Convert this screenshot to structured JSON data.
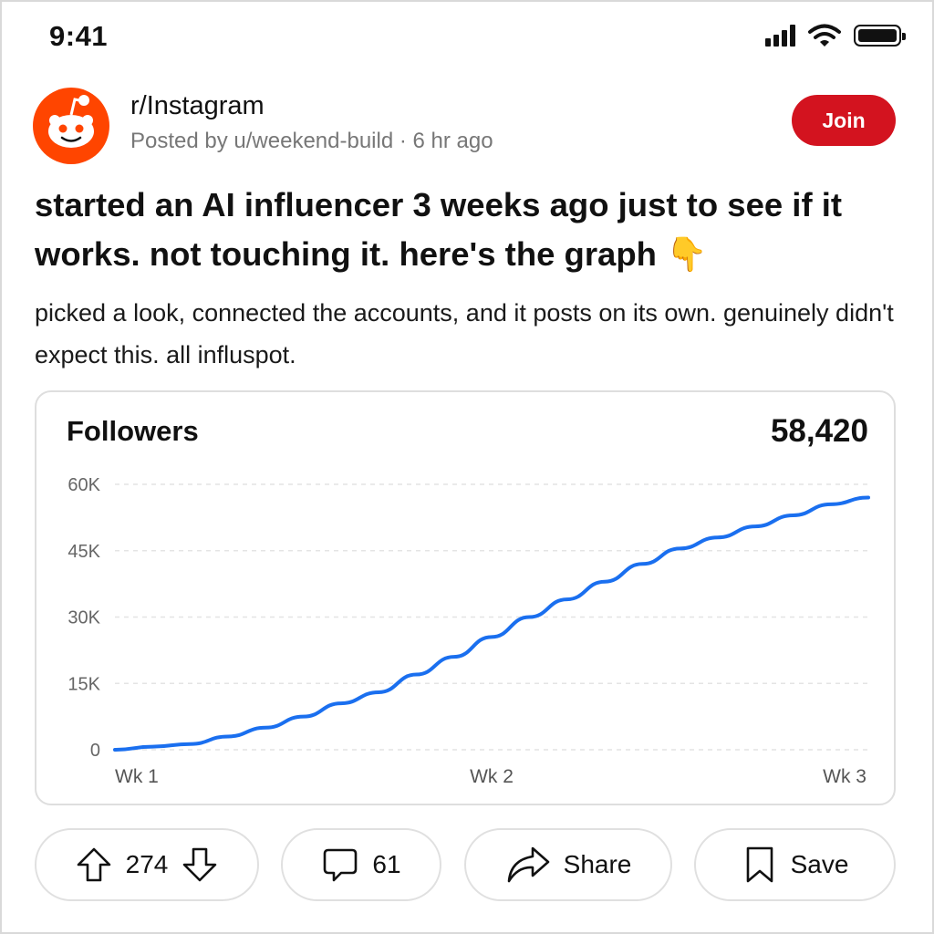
{
  "status_bar": {
    "time": "9:41"
  },
  "post": {
    "subreddit": "r/Instagram",
    "meta": "Posted by u/weekend-build · 6 hr ago",
    "join_label": "Join",
    "title": "started an AI influencer 3 weeks ago just to see if it works. not touching it. here's the graph 👇",
    "body": "picked a look, connected the accounts, and it posts on its own. genuinely didn't expect this. all influspot."
  },
  "card": {
    "title": "Followers",
    "total": "58,420"
  },
  "chart_data": {
    "type": "line",
    "title": "Followers",
    "ylim": [
      0,
      60000
    ],
    "yticks": [
      0,
      15000,
      30000,
      45000,
      60000
    ],
    "ytick_labels": [
      "0",
      "15K",
      "30K",
      "45K",
      "60K"
    ],
    "xlim": [
      1,
      3
    ],
    "xticks": [
      1,
      2,
      3
    ],
    "xtick_labels": [
      "Wk 1",
      "Wk 2",
      "Wk 3"
    ],
    "grid": true,
    "series_color": "#1a6fef",
    "x": [
      1.0,
      1.1,
      1.2,
      1.3,
      1.4,
      1.5,
      1.6,
      1.7,
      1.8,
      1.9,
      2.0,
      2.1,
      2.2,
      2.3,
      2.4,
      2.5,
      2.6,
      2.7,
      2.8,
      2.9,
      3.0
    ],
    "y": [
      0,
      700,
      1300,
      3000,
      5000,
      7500,
      10500,
      13000,
      17000,
      21000,
      25500,
      30000,
      34000,
      38000,
      42000,
      45500,
      48000,
      50500,
      53000,
      55500,
      57000
    ]
  },
  "actions": {
    "upvotes": "274",
    "comments": "61",
    "share_label": "Share",
    "save_label": "Save"
  },
  "icons": {
    "signal": "signal-bars-icon",
    "wifi": "wifi-icon",
    "battery": "battery-icon",
    "avatar": "reddit-snoo-icon",
    "upvote": "arrow-up-icon",
    "downvote": "arrow-down-icon",
    "comment": "comment-bubble-icon",
    "share": "share-arrow-icon",
    "save": "bookmark-icon"
  },
  "colors": {
    "brand": "#ff4500",
    "join": "#d3131f",
    "line": "#1a6fef"
  }
}
